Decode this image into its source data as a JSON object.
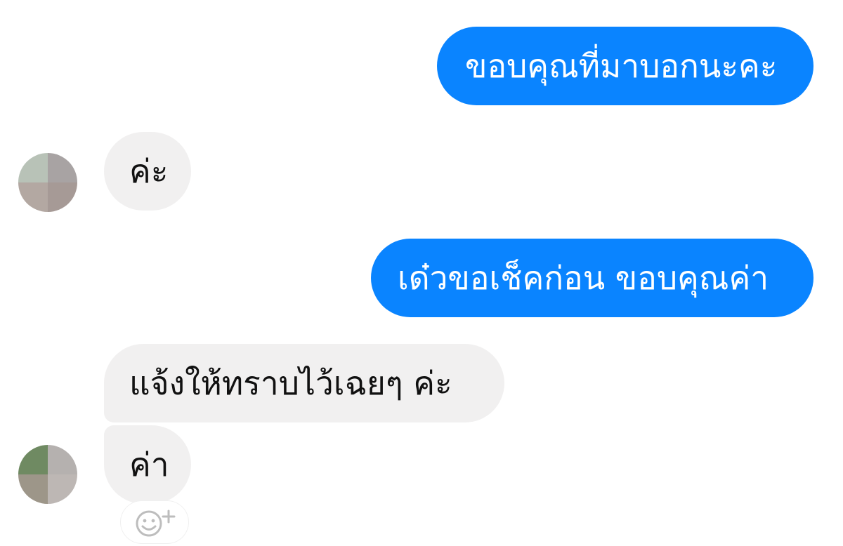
{
  "conversation": {
    "messages": [
      {
        "direction": "outgoing",
        "text": "ขอบคุณที่มาบอกนะคะ"
      },
      {
        "direction": "incoming",
        "text": "ค่ะ"
      },
      {
        "direction": "outgoing",
        "text": "เด๋วขอเช็คก่อน ขอบคุณค่า"
      },
      {
        "direction": "incoming",
        "text": "แจ้งให้ทราบไว้เฉยๆ ค่ะ"
      },
      {
        "direction": "incoming",
        "text": "ค่า"
      }
    ]
  },
  "avatars": {
    "first": {
      "icon": "pixelated-avatar",
      "colors": [
        "#b8c2b7",
        "#a8a3a3",
        "#b3a8a2",
        "#a69a96"
      ]
    },
    "second": {
      "icon": "pixelated-avatar",
      "colors": [
        "#6f8a62",
        "#b5b1af",
        "#9d9689",
        "#bdb7b4"
      ]
    }
  },
  "reaction_button": {
    "icon": "add-reaction-icon"
  },
  "theme": {
    "outgoing_bubble": "#0a84ff",
    "incoming_bubble": "#f1f0f0",
    "incoming_text": "#111111",
    "outgoing_text": "#ffffff"
  }
}
